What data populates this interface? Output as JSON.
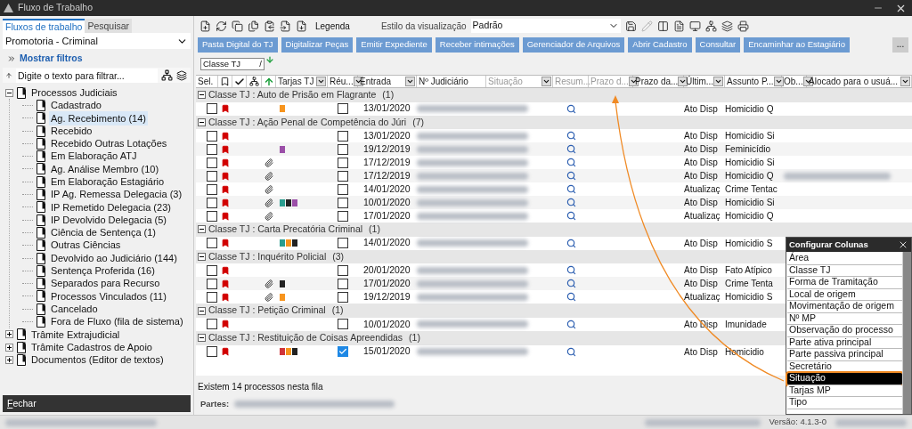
{
  "window": {
    "title": "Fluxo de Trabalho"
  },
  "left_panel": {
    "tabs": [
      {
        "label": "Fluxos de trabalho",
        "selected": true
      },
      {
        "label": "Pesquisar",
        "selected": false
      }
    ],
    "dropdown": {
      "value": "Promotoria - Criminal"
    },
    "filters_link": "Mostrar filtros",
    "filter": {
      "placeholder": "Digite o texto para filtrar..."
    },
    "tree": [
      {
        "label": "Processos Judiciais",
        "expanded": true,
        "selected": false,
        "children": [
          {
            "label": "Cadastrado",
            "selected": false
          },
          {
            "label": "Ag. Recebimento (14)",
            "selected": true
          },
          {
            "label": "Recebido",
            "selected": false
          },
          {
            "label": "Recebido Outras Lotações",
            "selected": false
          },
          {
            "label": "Em Elaboração ATJ",
            "selected": false
          },
          {
            "label": "Ag. Análise Membro (10)",
            "selected": false
          },
          {
            "label": "Em Elaboração Estagiário",
            "selected": false
          },
          {
            "label": "IP Ag. Remessa Delegacia (3)",
            "selected": false
          },
          {
            "label": "IP Remetido Delegacia (23)",
            "selected": false
          },
          {
            "label": "IP Devolvido Delegacia (5)",
            "selected": false
          },
          {
            "label": "Ciência de Sentença (1)",
            "selected": false
          },
          {
            "label": "Outras Ciências",
            "selected": false
          },
          {
            "label": "Devolvido ao Judiciário (144)",
            "selected": false
          },
          {
            "label": "Sentença Proferida (16)",
            "selected": false
          },
          {
            "label": "Separados para Recurso",
            "selected": false
          },
          {
            "label": "Processos Vinculados (11)",
            "selected": false
          },
          {
            "label": "Cancelado",
            "selected": false
          },
          {
            "label": "Fora de Fluxo (fila de sistema)",
            "selected": false
          }
        ]
      },
      {
        "label": "Trâmite Extrajudicial",
        "expanded": false,
        "selected": false
      },
      {
        "label": "Trâmite Cadastros de Apoio",
        "expanded": false,
        "selected": false
      },
      {
        "label": "Documentos (Editor de textos)",
        "expanded": false,
        "selected": false
      }
    ],
    "close_button": "Fechar"
  },
  "toolbar": {
    "legend_label": "Legenda",
    "style_label": "Estilo da visualização",
    "style_value": "Padrão"
  },
  "action_buttons": [
    "Pasta Digital do TJ",
    "Digitalizar Peças",
    "Emitir Expediente",
    "Receber intimações",
    "Gerenciador de Arquivos",
    "Abrir Cadastro",
    "Consultar",
    "Encaminhar ao Estagiário"
  ],
  "more_button": "...",
  "grouping": {
    "chip": "Classe TJ",
    "separator": "/"
  },
  "table": {
    "columns": [
      {
        "kind": "text",
        "label": "Sel.",
        "filter": false,
        "disabled": false
      },
      {
        "kind": "bookmark"
      },
      {
        "kind": "check"
      },
      {
        "kind": "tree"
      },
      {
        "kind": "sort"
      },
      {
        "kind": "text",
        "label": "Tarjas TJ",
        "filter": true,
        "disabled": false
      },
      {
        "kind": "text",
        "label": "Réu...",
        "filter": true,
        "disabled": false
      },
      {
        "kind": "text",
        "label": "Entrada",
        "filter": true,
        "disabled": false
      },
      {
        "kind": "text",
        "label": "Nº Judiciário",
        "filter": false,
        "disabled": false
      },
      {
        "kind": "text",
        "label": "Situação",
        "filter": true,
        "disabled": true
      },
      {
        "kind": "text",
        "label": "Resum...",
        "filter": false,
        "disabled": true
      },
      {
        "kind": "text",
        "label": "Prazo d...",
        "filter": true,
        "disabled": true
      },
      {
        "kind": "text",
        "label": "Prazo da...",
        "filter": true,
        "disabled": false
      },
      {
        "kind": "text",
        "label": "Últim...",
        "filter": true,
        "disabled": false
      },
      {
        "kind": "text",
        "label": "Assunto P...",
        "filter": true,
        "disabled": false
      },
      {
        "kind": "text",
        "label": "Ob...",
        "filter": true,
        "disabled": false
      },
      {
        "kind": "text",
        "label": "Alocado para o usuá...",
        "filter": true,
        "disabled": false
      }
    ],
    "groups": [
      {
        "label": "Classe TJ : Auto de Prisão em Flagrante",
        "count": "(1)",
        "expanded": true,
        "rows": [
          {
            "selected": false,
            "attachment": false,
            "tarjas": [
              {
                "color": "#f7941d"
              }
            ],
            "reu": false,
            "date": "13/01/2020",
            "ultimo": "Ato Disp",
            "assunto": "Homicidio Q",
            "redacted_name": false
          }
        ]
      },
      {
        "label": "Classe TJ : Ação Penal de Competência do Júri",
        "count": "(7)",
        "expanded": true,
        "rows": [
          {
            "selected": false,
            "attachment": false,
            "tarjas": [],
            "reu": false,
            "date": "13/01/2020",
            "ultimo": "Ato Disp",
            "assunto": "Homicidio Si",
            "redacted_name": false
          },
          {
            "selected": false,
            "attachment": false,
            "tarjas": [
              {
                "color": "#9b4fa8"
              }
            ],
            "reu": false,
            "date": "19/12/2019",
            "ultimo": "Ato Disp",
            "assunto": "Feminicídio",
            "redacted_name": false
          },
          {
            "selected": false,
            "attachment": true,
            "tarjas": [],
            "reu": false,
            "date": "17/12/2019",
            "ultimo": "Ato Disp",
            "assunto": "Homicidio Si",
            "redacted_name": false
          },
          {
            "selected": false,
            "attachment": true,
            "tarjas": [],
            "reu": false,
            "date": "17/12/2019",
            "ultimo": "Ato Disp",
            "assunto": "Homicidio Q",
            "redacted_name": true
          },
          {
            "selected": false,
            "attachment": true,
            "tarjas": [],
            "reu": false,
            "date": "14/01/2020",
            "ultimo": "Atualizaç",
            "assunto": "Crime Tentac",
            "redacted_name": false
          },
          {
            "selected": false,
            "attachment": true,
            "tarjas": [
              {
                "color": "#2a9d8f"
              },
              {
                "color": "#222222"
              },
              {
                "color": "#9b4fa8"
              }
            ],
            "reu": false,
            "date": "10/01/2020",
            "ultimo": "Ato Disp",
            "assunto": "Homicidio Si",
            "redacted_name": false
          },
          {
            "selected": false,
            "attachment": true,
            "tarjas": [],
            "reu": false,
            "date": "17/01/2020",
            "ultimo": "Atualizaç",
            "assunto": "Homicidio Q",
            "redacted_name": false
          }
        ]
      },
      {
        "label": "Classe TJ : Carta Precatória Criminal",
        "count": "(1)",
        "expanded": true,
        "rows": [
          {
            "selected": false,
            "attachment": false,
            "tarjas": [
              {
                "color": "#2a9d8f"
              },
              {
                "color": "#f7941d"
              },
              {
                "color": "#222222"
              }
            ],
            "reu": false,
            "date": "14/01/2020",
            "ultimo": "Ato Disp",
            "assunto": "Homicidio S",
            "redacted_name": false
          }
        ]
      },
      {
        "label": "Classe TJ : Inquérito Policial",
        "count": "(3)",
        "expanded": true,
        "rows": [
          {
            "selected": false,
            "attachment": false,
            "tarjas": [],
            "reu": false,
            "date": "20/01/2020",
            "ultimo": "Ato Disp",
            "assunto": "Fato Atípico",
            "redacted_name": false
          },
          {
            "selected": false,
            "attachment": true,
            "tarjas": [
              {
                "color": "#222222"
              }
            ],
            "reu": false,
            "date": "17/01/2020",
            "ultimo": "Ato Disp",
            "assunto": "Crime Tenta",
            "redacted_name": false
          },
          {
            "selected": false,
            "attachment": true,
            "tarjas": [
              {
                "color": "#f7941d"
              }
            ],
            "reu": false,
            "date": "19/12/2019",
            "ultimo": "Atualizaç",
            "assunto": "Homicidio S",
            "redacted_name": false
          }
        ]
      },
      {
        "label": "Classe TJ : Petição Criminal",
        "count": "(1)",
        "expanded": true,
        "rows": [
          {
            "selected": false,
            "attachment": false,
            "tarjas": [],
            "reu": false,
            "date": "10/01/2020",
            "ultimo": "Ato Disp",
            "assunto": "Imunidade",
            "redacted_name": false
          }
        ]
      },
      {
        "label": "Classe TJ : Restituição de Coisas Apreendidas",
        "count": "(1)",
        "expanded": true,
        "rows": [
          {
            "selected": false,
            "attachment": false,
            "tarjas": [
              {
                "color": "#d0343a"
              },
              {
                "color": "#f7941d"
              },
              {
                "color": "#222222"
              }
            ],
            "reu": true,
            "date": "15/01/2020",
            "ultimo": "Ato Disp",
            "assunto": "Homicidio",
            "redacted_name": false
          }
        ]
      }
    ]
  },
  "summary": "Existem 14 processos nesta fila",
  "parties_label": "Partes:",
  "status_bar": {
    "version": "Versão: 4.1.3-0"
  },
  "column_config": {
    "title": "Configurar Colunas",
    "items": [
      {
        "label": "Área",
        "selected": false
      },
      {
        "label": "Classe TJ",
        "selected": false
      },
      {
        "label": "Forma de Tramitação",
        "selected": false
      },
      {
        "label": "Local de origem",
        "selected": false
      },
      {
        "label": "Movimentação de origem",
        "selected": false
      },
      {
        "label": "Nº MP",
        "selected": false
      },
      {
        "label": "Observação do processo",
        "selected": false
      },
      {
        "label": "Parte ativa principal",
        "selected": false
      },
      {
        "label": "Parte passiva principal",
        "selected": false
      },
      {
        "label": "Secretário",
        "selected": false
      },
      {
        "label": "Situação",
        "selected": true
      },
      {
        "label": "Tarjas MP",
        "selected": false
      },
      {
        "label": "Tipo",
        "selected": false
      }
    ]
  }
}
